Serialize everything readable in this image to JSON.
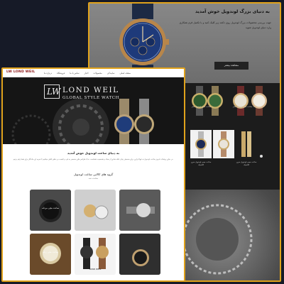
{
  "back_page": {
    "hero_title": "به دنیای بزرگ لوندویل خوش آمدید",
    "hero_text": "جهت بررسی محصولات بزرگ لوندویل روی دکمه زیر کلیک کنید و با تکمیل فرم همکاری وارد دنیای لوندویل شوید",
    "hero_button": "مشاهده بیشتر",
    "product_caption": "ساعت مچی لوندویل مدل ...",
    "product_caption_2": "ساعت مچی لوندویل سری کلاسیک"
  },
  "front_page": {
    "logo_text": "LW LOND WEIL",
    "menu": [
      "درباره ما",
      "فروشگاه",
      "تماس با ما",
      "اخبار",
      "محصولات",
      "نمایندگی",
      "صفحه اصلی"
    ],
    "brand_monogram": "LW",
    "brand_name": "LOND WEIL",
    "tagline": "GLOBAL STYLE WATCH",
    "welcome_heading": "به دنیای ساعت لوندویل خوش آمدید",
    "welcome_text": "در دنیای پرشتاب امروز ساعت لوندویل نه تنها ابزاری برای سنجش زمان بلکه نمادی از سبک و شخصیت شماست. ما با طراحی های منحصر به فرد و کیفیت بی نظیر تلاش میکنیم تا تجربه ای ماندگار برای شما رقم بزنیم.",
    "collection_heading": "گروه های کالایی ساعت لوندویل",
    "collection_sub": "مشاهده همه",
    "tiles": [
      {
        "label": "ساعت مچی مردانه"
      },
      {
        "label": ""
      },
      {
        "label": ""
      },
      {
        "label": "ساعت مچی زنانه"
      },
      {
        "label": ""
      },
      {
        "label": ""
      }
    ],
    "tile_logo": "LOND WEIL"
  },
  "colors": {
    "accent_border": "#e0a21b",
    "logo_red": "#8b1515",
    "background": "#161a27"
  }
}
